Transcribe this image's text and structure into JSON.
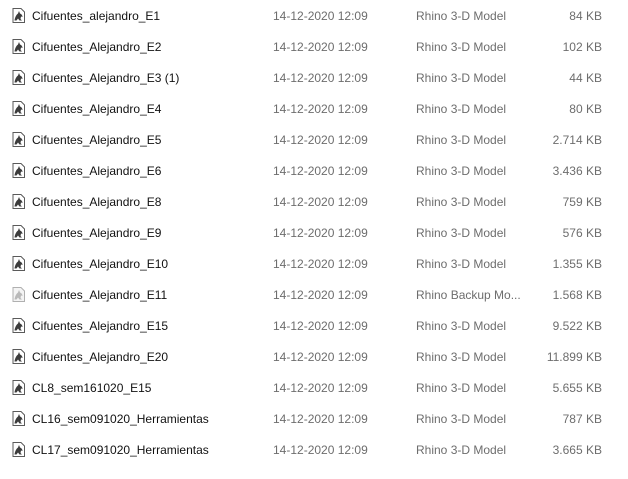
{
  "files": [
    {
      "name": "Cifuentes_alejandro_E1",
      "date": "14-12-2020 12:09",
      "type": "Rhino 3-D Model",
      "size": "84 KB",
      "icon": "rhino-model-icon"
    },
    {
      "name": "Cifuentes_Alejandro_E2",
      "date": "14-12-2020 12:09",
      "type": "Rhino 3-D Model",
      "size": "102 KB",
      "icon": "rhino-model-icon"
    },
    {
      "name": "Cifuentes_Alejandro_E3 (1)",
      "date": "14-12-2020 12:09",
      "type": "Rhino 3-D Model",
      "size": "44 KB",
      "icon": "rhino-model-icon"
    },
    {
      "name": "Cifuentes_Alejandro_E4",
      "date": "14-12-2020 12:09",
      "type": "Rhino 3-D Model",
      "size": "80 KB",
      "icon": "rhino-model-icon"
    },
    {
      "name": "Cifuentes_Alejandro_E5",
      "date": "14-12-2020 12:09",
      "type": "Rhino 3-D Model",
      "size": "2.714 KB",
      "icon": "rhino-model-icon"
    },
    {
      "name": "Cifuentes_Alejandro_E6",
      "date": "14-12-2020 12:09",
      "type": "Rhino 3-D Model",
      "size": "3.436 KB",
      "icon": "rhino-model-icon"
    },
    {
      "name": "Cifuentes_Alejandro_E8",
      "date": "14-12-2020 12:09",
      "type": "Rhino 3-D Model",
      "size": "759 KB",
      "icon": "rhino-model-icon"
    },
    {
      "name": "Cifuentes_Alejandro_E9",
      "date": "14-12-2020 12:09",
      "type": "Rhino 3-D Model",
      "size": "576 KB",
      "icon": "rhino-model-icon"
    },
    {
      "name": "Cifuentes_Alejandro_E10",
      "date": "14-12-2020 12:09",
      "type": "Rhino 3-D Model",
      "size": "1.355 KB",
      "icon": "rhino-model-icon"
    },
    {
      "name": "Cifuentes_Alejandro_E11",
      "date": "14-12-2020 12:09",
      "type": "Rhino Backup Mo...",
      "size": "1.568 KB",
      "icon": "rhino-backup-icon"
    },
    {
      "name": "Cifuentes_Alejandro_E15",
      "date": "14-12-2020 12:09",
      "type": "Rhino 3-D Model",
      "size": "9.522 KB",
      "icon": "rhino-model-icon"
    },
    {
      "name": "Cifuentes_Alejandro_E20",
      "date": "14-12-2020 12:09",
      "type": "Rhino 3-D Model",
      "size": "11.899 KB",
      "icon": "rhino-model-icon"
    },
    {
      "name": "CL8_sem161020_E15",
      "date": "14-12-2020 12:09",
      "type": "Rhino 3-D Model",
      "size": "5.655 KB",
      "icon": "rhino-model-icon"
    },
    {
      "name": "CL16_sem091020_Herramientas",
      "date": "14-12-2020 12:09",
      "type": "Rhino 3-D Model",
      "size": "787 KB",
      "icon": "rhino-model-icon"
    },
    {
      "name": "CL17_sem091020_Herramientas",
      "date": "14-12-2020 12:09",
      "type": "Rhino 3-D Model",
      "size": "3.665 KB",
      "icon": "rhino-model-icon"
    }
  ],
  "colors": {
    "model_icon": "#3c3c3c",
    "backup_icon": "#b9b9b9",
    "secondary_text": "#6d6d6d"
  }
}
